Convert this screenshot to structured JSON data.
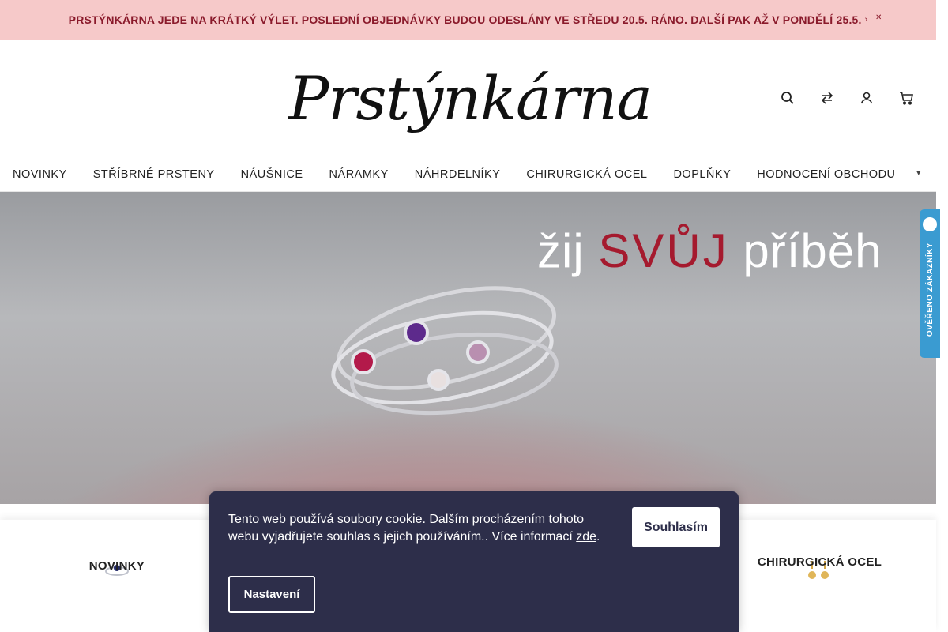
{
  "announcement": {
    "text": "PRSTÝNKÁRNA JEDE NA KRÁTKÝ VÝLET. POSLEDNÍ OBJEDNÁVKY BUDOU ODESLÁNY VE STŘEDU 20.5. RÁNO. DALŠÍ PAK AŽ V PONDĚLÍ 25.5.",
    "background": "#f6c9c9",
    "text_color": "#8a1a2b"
  },
  "logo": {
    "text": "Prstýnkárna"
  },
  "header_icons": [
    "search-icon",
    "compare-icon",
    "user-icon",
    "cart-icon"
  ],
  "nav": {
    "items": [
      "NOVINKY",
      "STŘÍBRNÉ PRSTENY",
      "NÁUŠNICE",
      "NÁRAMKY",
      "NÁHRDELNÍKY",
      "CHIRURGICKÁ OCEL",
      "DOPLŇKY",
      "HODNOCENÍ OBCHODU"
    ]
  },
  "hero": {
    "tagline_pre": "žij",
    "tagline_accent": "SVŮJ",
    "tagline_post": "příběh",
    "accent_color": "#a51a2e"
  },
  "trust_badge": {
    "text": "OVĚŘENO ZÁKAZNÍKY",
    "color": "#3a9bd1"
  },
  "categories": [
    {
      "label": "NOVINKY",
      "icon": "ring-icon"
    },
    {
      "label": "CHIRURGICKÁ OCEL",
      "icon": "earrings-icon"
    }
  ],
  "cookie": {
    "text": "Tento web používá soubory cookie. Dalším procházením tohoto webu vyjadřujete souhlas s jejich používáním.. Více informací",
    "link_text": "zde",
    "trailing": ".",
    "accept_label": "Souhlasím",
    "settings_label": "Nastavení",
    "background": "#2d2e4a"
  }
}
